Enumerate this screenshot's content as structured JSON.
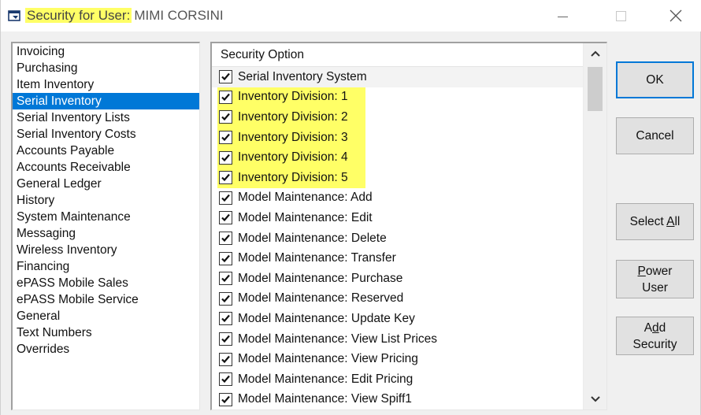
{
  "window": {
    "title_highlighted": "Security for User:",
    "title_user": "MIMI CORSINI",
    "minimize_icon": "minimize-icon",
    "maximize_icon": "maximize-icon",
    "close_icon": "close-icon"
  },
  "categories": [
    "Invoicing",
    "Purchasing",
    "Item Inventory",
    "Serial Inventory",
    "Serial Inventory Lists",
    "Serial Inventory Costs",
    "Accounts Payable",
    "Accounts Receivable",
    "General Ledger",
    "History",
    "System Maintenance",
    "Messaging",
    "Wireless Inventory",
    "Financing",
    "ePASS Mobile Sales",
    "ePASS Mobile Service",
    "General",
    "Text Numbers",
    "Overrides"
  ],
  "selected_category": "Serial Inventory",
  "security_list": {
    "header": "Security Option",
    "options": [
      {
        "label": "Serial Inventory System",
        "checked": true,
        "highlighted": false
      },
      {
        "label": "Inventory Division: 1",
        "checked": true,
        "highlighted": true
      },
      {
        "label": "Inventory Division: 2",
        "checked": true,
        "highlighted": true
      },
      {
        "label": "Inventory Division: 3",
        "checked": true,
        "highlighted": true
      },
      {
        "label": "Inventory Division: 4",
        "checked": true,
        "highlighted": true
      },
      {
        "label": "Inventory Division: 5",
        "checked": true,
        "highlighted": true
      },
      {
        "label": "Model Maintenance: Add",
        "checked": true,
        "highlighted": false
      },
      {
        "label": "Model Maintenance: Edit",
        "checked": true,
        "highlighted": false
      },
      {
        "label": "Model Maintenance: Delete",
        "checked": true,
        "highlighted": false
      },
      {
        "label": "Model Maintenance: Transfer",
        "checked": true,
        "highlighted": false
      },
      {
        "label": "Model Maintenance: Purchase",
        "checked": true,
        "highlighted": false
      },
      {
        "label": "Model Maintenance: Reserved",
        "checked": true,
        "highlighted": false
      },
      {
        "label": "Model Maintenance: Update Key",
        "checked": true,
        "highlighted": false
      },
      {
        "label": "Model Maintenance: View List Prices",
        "checked": true,
        "highlighted": false
      },
      {
        "label": "Model Maintenance: View Pricing",
        "checked": true,
        "highlighted": false
      },
      {
        "label": "Model Maintenance: Edit Pricing",
        "checked": true,
        "highlighted": false
      },
      {
        "label": "Model Maintenance: View Spiff1",
        "checked": true,
        "highlighted": false
      }
    ]
  },
  "buttons": {
    "ok": "OK",
    "cancel": "Cancel",
    "select_all_pre": "Select ",
    "select_all_u": "A",
    "select_all_post": "ll",
    "power_u": "P",
    "power_rest": "ower",
    "power_line2": "User",
    "add_pre": "A",
    "add_u": "d",
    "add_post": "d",
    "add_line2": "Security"
  },
  "colors": {
    "highlight": "#ffff66",
    "selection": "#0078d7"
  }
}
